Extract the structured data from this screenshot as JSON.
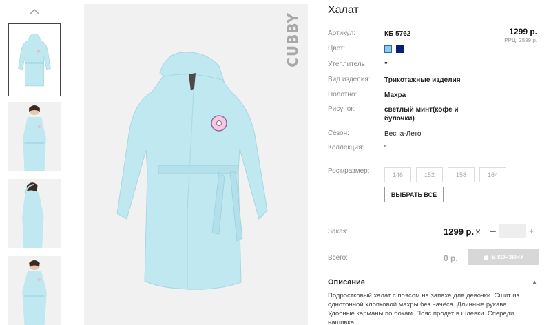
{
  "product": {
    "title": "Халат",
    "price": "1299 р.",
    "rrp": "РРЦ: 2599 р.",
    "brand_logo": "CUBBY",
    "attributes": [
      {
        "label": "Артикул:",
        "value": "КБ 5762"
      },
      {
        "label": "Цвет:",
        "value": ""
      },
      {
        "label": "Утеплитель:",
        "value": "\""
      },
      {
        "label": "Вид изделия:",
        "value": "Трикотажные изделия"
      },
      {
        "label": "Полотно:",
        "value": "Махра"
      },
      {
        "label": "Рисунок:",
        "value": "светлый минт(кофе и булочки)"
      },
      {
        "label": "Сезон:",
        "value": "Весна-Лето"
      },
      {
        "label": "Коллекция:",
        "value": "\""
      }
    ],
    "colors": [
      "#8ec9f0",
      "#0d1e7a"
    ],
    "size_label": "Рост/размер:",
    "sizes": [
      "146",
      "152",
      "158",
      "164"
    ],
    "select_all": "ВЫБРАТЬ ВСЕ"
  },
  "order": {
    "label": "Заказ:",
    "price": "1299 р.",
    "times": "×",
    "minus": "–",
    "plus": "+",
    "quantity": ""
  },
  "total": {
    "label": "Всего:",
    "value": "0 р.",
    "cart_button": "В КОРЗИНУ"
  },
  "description": {
    "heading": "Описание",
    "toggle": "▲",
    "text": "Подростковый халат с поясом на запахе для девочки. Сшит из однотонной хлопковой махры без начёса. Длинные рукава. Удобные карманы по бокам. Пояс продет в шлевки. Спереди нашивка."
  },
  "icons": {
    "thumb_up": "chevron-up-icon",
    "cart": "cart-icon",
    "donut": "donut-patch-icon"
  },
  "colors": {
    "robe": "#bfe8f0",
    "cart_button": "#d7d7d7"
  }
}
